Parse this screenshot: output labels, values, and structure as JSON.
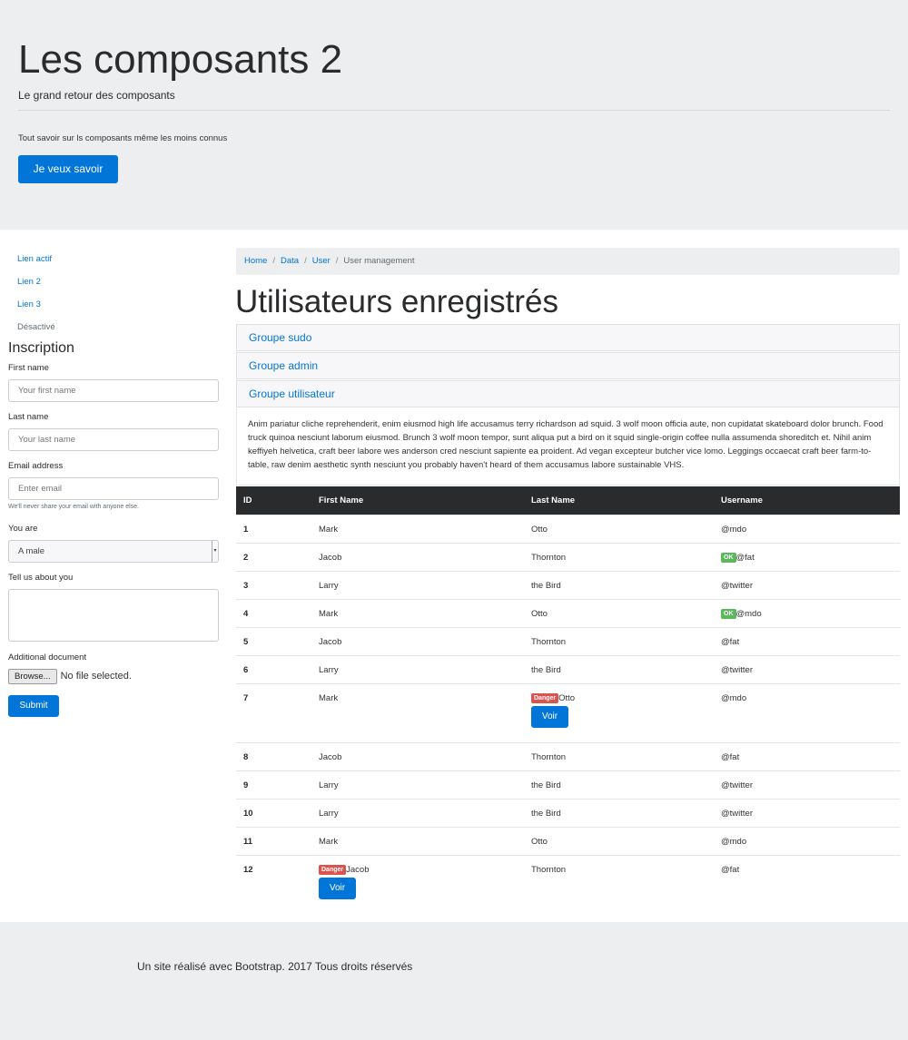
{
  "jumbotron": {
    "title": "Les composants 2",
    "lead": "Le grand retour des composants",
    "subtitle": "Tout savoir sur ls composants même les moins connus",
    "button_label": "Je veux savoir"
  },
  "sidenav": {
    "items": [
      {
        "label": "Lien actif",
        "disabled": false
      },
      {
        "label": "Lien 2",
        "disabled": false
      },
      {
        "label": "Lien 3",
        "disabled": false
      },
      {
        "label": "Désactivé",
        "disabled": true
      }
    ]
  },
  "form": {
    "title": "Inscription",
    "first_name_label": "First name",
    "first_name_placeholder": "Your first name",
    "last_name_label": "Last name",
    "last_name_placeholder": "Your last name",
    "email_label": "Email address",
    "email_placeholder": "Enter email",
    "email_help": "We'll never share your email with anyone else.",
    "gender_label": "You are",
    "gender_value": "A male",
    "about_label": "Tell us about you",
    "document_label": "Additional document",
    "browse_label": "Browse...",
    "file_status": "No file selected.",
    "submit_label": "Submit"
  },
  "breadcrumb": {
    "items": [
      "Home",
      "Data",
      "User"
    ],
    "active": "User management"
  },
  "main": {
    "title": "Utilisateurs enregistrés",
    "groups": [
      "Groupe sudo",
      "Groupe admin",
      "Groupe utilisateur"
    ],
    "group_body": "Anim pariatur cliche reprehenderit, enim eiusmod high life accusamus terry richardson ad squid. 3 wolf moon officia aute, non cupidatat skateboard dolor brunch. Food truck quinoa nesciunt laborum eiusmod. Brunch 3 wolf moon tempor, sunt aliqua put a bird on it squid single-origin coffee nulla assumenda shoreditch et. Nihil anim keffiyeh helvetica, craft beer labore wes anderson cred nesciunt sapiente ea proident. Ad vegan excepteur butcher vice lomo. Leggings occaecat craft beer farm-to-table, raw denim aesthetic synth nesciunt you probably haven't heard of them accusamus labore sustainable VHS."
  },
  "table": {
    "headers": [
      "ID",
      "First Name",
      "Last Name",
      "Username"
    ],
    "ok_badge": "OK",
    "danger_badge": "Danger",
    "voir_label": "Voir",
    "rows": [
      {
        "id": "1",
        "first": "Mark",
        "last": "Otto",
        "user": "@mdo"
      },
      {
        "id": "2",
        "first": "Jacob",
        "last": "Thornton",
        "user": "@fat",
        "user_badge": "ok"
      },
      {
        "id": "3",
        "first": "Larry",
        "last": "the Bird",
        "user": "@twitter"
      },
      {
        "id": "4",
        "first": "Mark",
        "last": "Otto",
        "user": "@mdo",
        "user_badge": "ok"
      },
      {
        "id": "5",
        "first": "Jacob",
        "last": "Thornton",
        "user": "@fat"
      },
      {
        "id": "6",
        "first": "Larry",
        "last": "the Bird",
        "user": "@twitter"
      },
      {
        "id": "7",
        "first": "Mark",
        "last": "Otto",
        "user": "@mdo",
        "last_badge": "danger",
        "last_voir": true
      },
      {
        "id": "8",
        "first": "Jacob",
        "last": "Thornton",
        "user": "@fat"
      },
      {
        "id": "9",
        "first": "Larry",
        "last": "the Bird",
        "user": "@twitter"
      },
      {
        "id": "10",
        "first": "Larry",
        "last": "the Bird",
        "user": "@twitter"
      },
      {
        "id": "11",
        "first": "Mark",
        "last": "Otto",
        "user": "@mdo"
      },
      {
        "id": "12",
        "first": "Jacob",
        "last": "Thornton",
        "user": "@fat",
        "first_badge": "danger",
        "first_voir": true
      }
    ]
  },
  "footer": {
    "text": "Un site réalisé avec Bootstrap. 2017 Tous droits réservés"
  }
}
